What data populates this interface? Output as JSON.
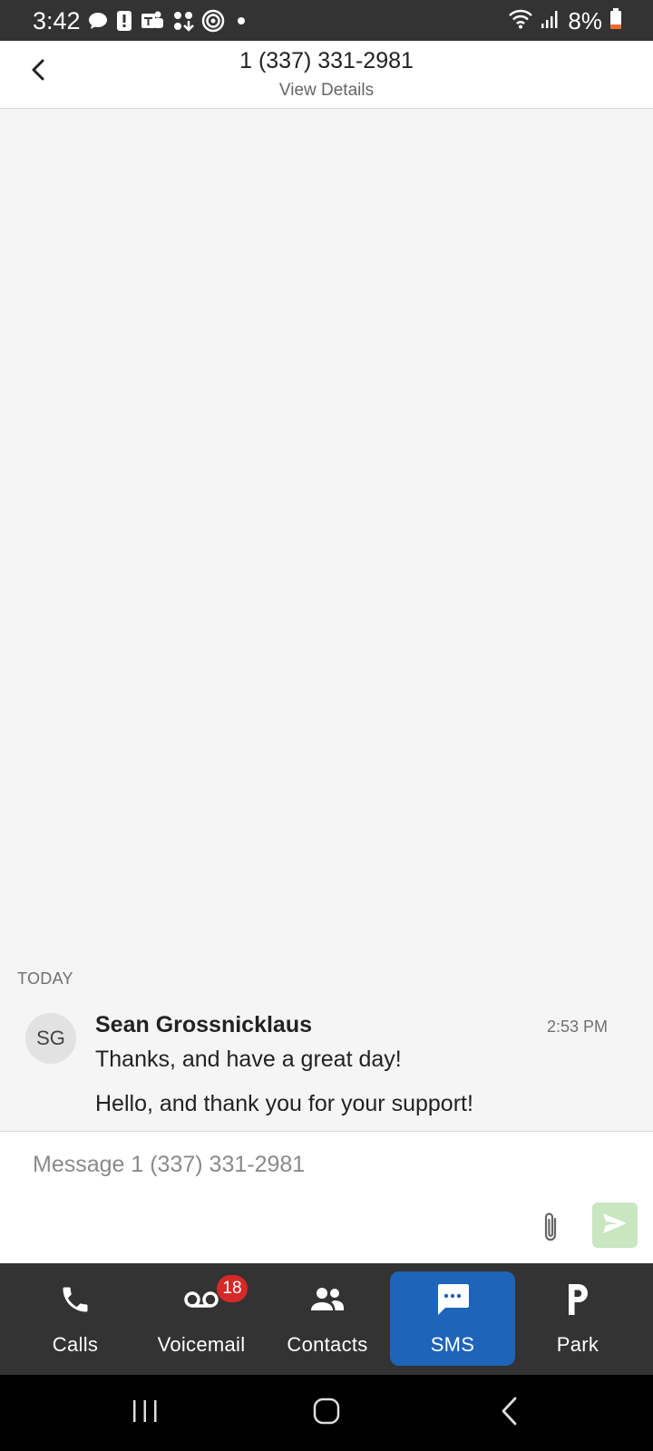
{
  "status_bar": {
    "time": "3:42",
    "battery": "8%",
    "icons": [
      "chat-bubble-icon",
      "alert-icon",
      "teams-icon",
      "app-icon",
      "target-icon",
      "dot-icon",
      "wifi-icon",
      "signal-icon",
      "battery-icon"
    ]
  },
  "header": {
    "title": "1 (337) 331-2981",
    "subtitle": "View Details"
  },
  "conversation": {
    "day_label": "TODAY",
    "avatar_initials": "SG",
    "sender": "Sean Grossnicklaus",
    "time": "2:53 PM",
    "messages": [
      "Thanks, and have a great day!",
      "Hello, and thank you for your support!"
    ]
  },
  "compose": {
    "placeholder": "Message 1 (337) 331-2981"
  },
  "nav": {
    "calls": "Calls",
    "voicemail": "Voicemail",
    "voicemail_badge": "18",
    "contacts": "Contacts",
    "sms": "SMS",
    "park": "Park"
  },
  "colors": {
    "accent": "#1e64b8",
    "badge": "#d62828",
    "send_button": "#c8e6c0",
    "nav_background": "#333333"
  }
}
